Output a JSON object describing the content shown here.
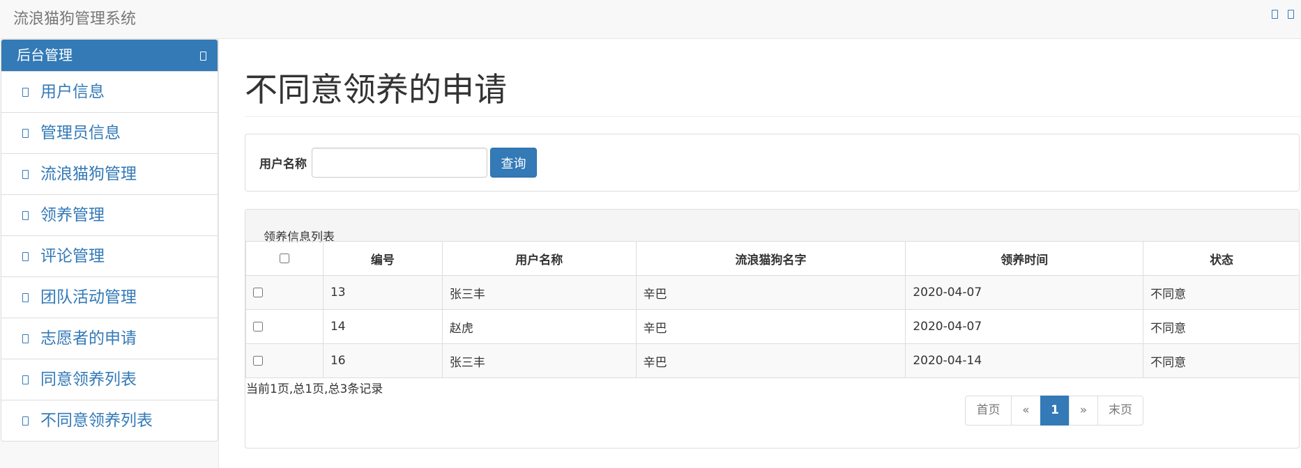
{
  "navbar": {
    "brand": "流浪猫狗管理系统",
    "icons": [
      "window-icon",
      "window-icon"
    ]
  },
  "sidebar": {
    "header": "后台管理",
    "items": [
      {
        "label": "用户信息"
      },
      {
        "label": "管理员信息"
      },
      {
        "label": "流浪猫狗管理"
      },
      {
        "label": "领养管理"
      },
      {
        "label": "评论管理"
      },
      {
        "label": "团队活动管理"
      },
      {
        "label": "志愿者的申请"
      },
      {
        "label": "同意领养列表"
      },
      {
        "label": "不同意领养列表"
      }
    ]
  },
  "main": {
    "title": "不同意领养的申请",
    "search": {
      "label": "用户名称",
      "value": "",
      "button": "查询"
    },
    "list": {
      "heading": "领养信息列表",
      "columns": [
        "编号",
        "用户名称",
        "流浪猫狗名字",
        "领养时间",
        "状态"
      ],
      "rows": [
        {
          "id": "13",
          "user": "张三丰",
          "pet": "辛巴",
          "time": "2020-04-07",
          "status": "不同意"
        },
        {
          "id": "14",
          "user": "赵虎",
          "pet": "辛巴",
          "time": "2020-04-07",
          "status": "不同意"
        },
        {
          "id": "16",
          "user": "张三丰",
          "pet": "辛巴",
          "time": "2020-04-14",
          "status": "不同意"
        }
      ],
      "records": "当前1页,总1页,总3条记录"
    },
    "pagination": {
      "first": "首页",
      "prev": "«",
      "current": "1",
      "next": "»",
      "last": "末页"
    }
  },
  "colors": {
    "primary": "#337ab7",
    "navbar_bg": "#f8f8f8"
  }
}
